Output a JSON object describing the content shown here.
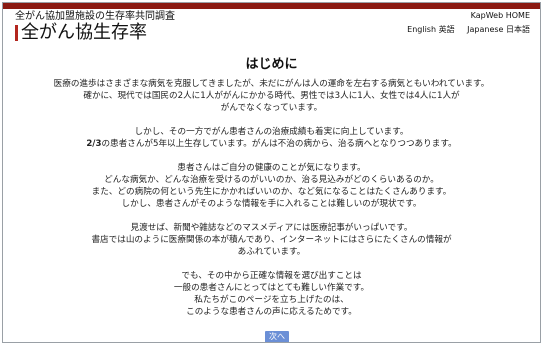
{
  "header": {
    "subtitle": "全がん協加盟施設の生存率共同調査",
    "title": "全がん協生存率",
    "home_link": "KapWeb HOME",
    "lang_en": "English 英語",
    "lang_ja": "Japanese 日本語"
  },
  "main": {
    "title": "はじめに",
    "paragraphs": [
      [
        "医療の進歩はさまざまな病気を克服してきましたが、未だにがんは人の運命を左右する病気ともいわれています。",
        "確かに、現代では国民の2人に1人ががんにかかる時代、男性では3人に1人、女性では4人に1人が",
        "がんでなくなっています。"
      ],
      [
        "しかし、その一方でがん患者さんの治療成績も着実に向上しています。",
        "2/3の患者さんが5年以上生存しています。がんは不治の病から、治る病へとなりつつあります。"
      ],
      [
        "患者さんはご自分の健康のことが気になります。",
        "どんな病気か、どんな治療を受けるのがいいのか、治る見込みがどのくらいあるのか。",
        "また、どの病院の何という先生にかかればいいのか、など気になることはたくさんあります。",
        "しかし、患者さんがそのような情報を手に入れることは難しいのが現状です。"
      ],
      [
        "見渡せば、新聞や雑誌などのマスメディアには医療記事がいっぱいです。",
        "書店では山のように医療関係の本が積んであり、インターネットにはさらにたくさんの情報が",
        "あふれています。"
      ],
      [
        "でも、その中から正確な情報を選び出すことは",
        "一般の患者さんにとってはとても難しい作業です。",
        "私たちがこのページを立ち上げたのは、",
        "このような患者さんの声に応えるためです。"
      ]
    ]
  },
  "nav": {
    "next_label": "次へ"
  },
  "colors": {
    "topbar": "#8b1a12",
    "brand_mark": "#b3261e",
    "button": "#6b8fd6"
  }
}
